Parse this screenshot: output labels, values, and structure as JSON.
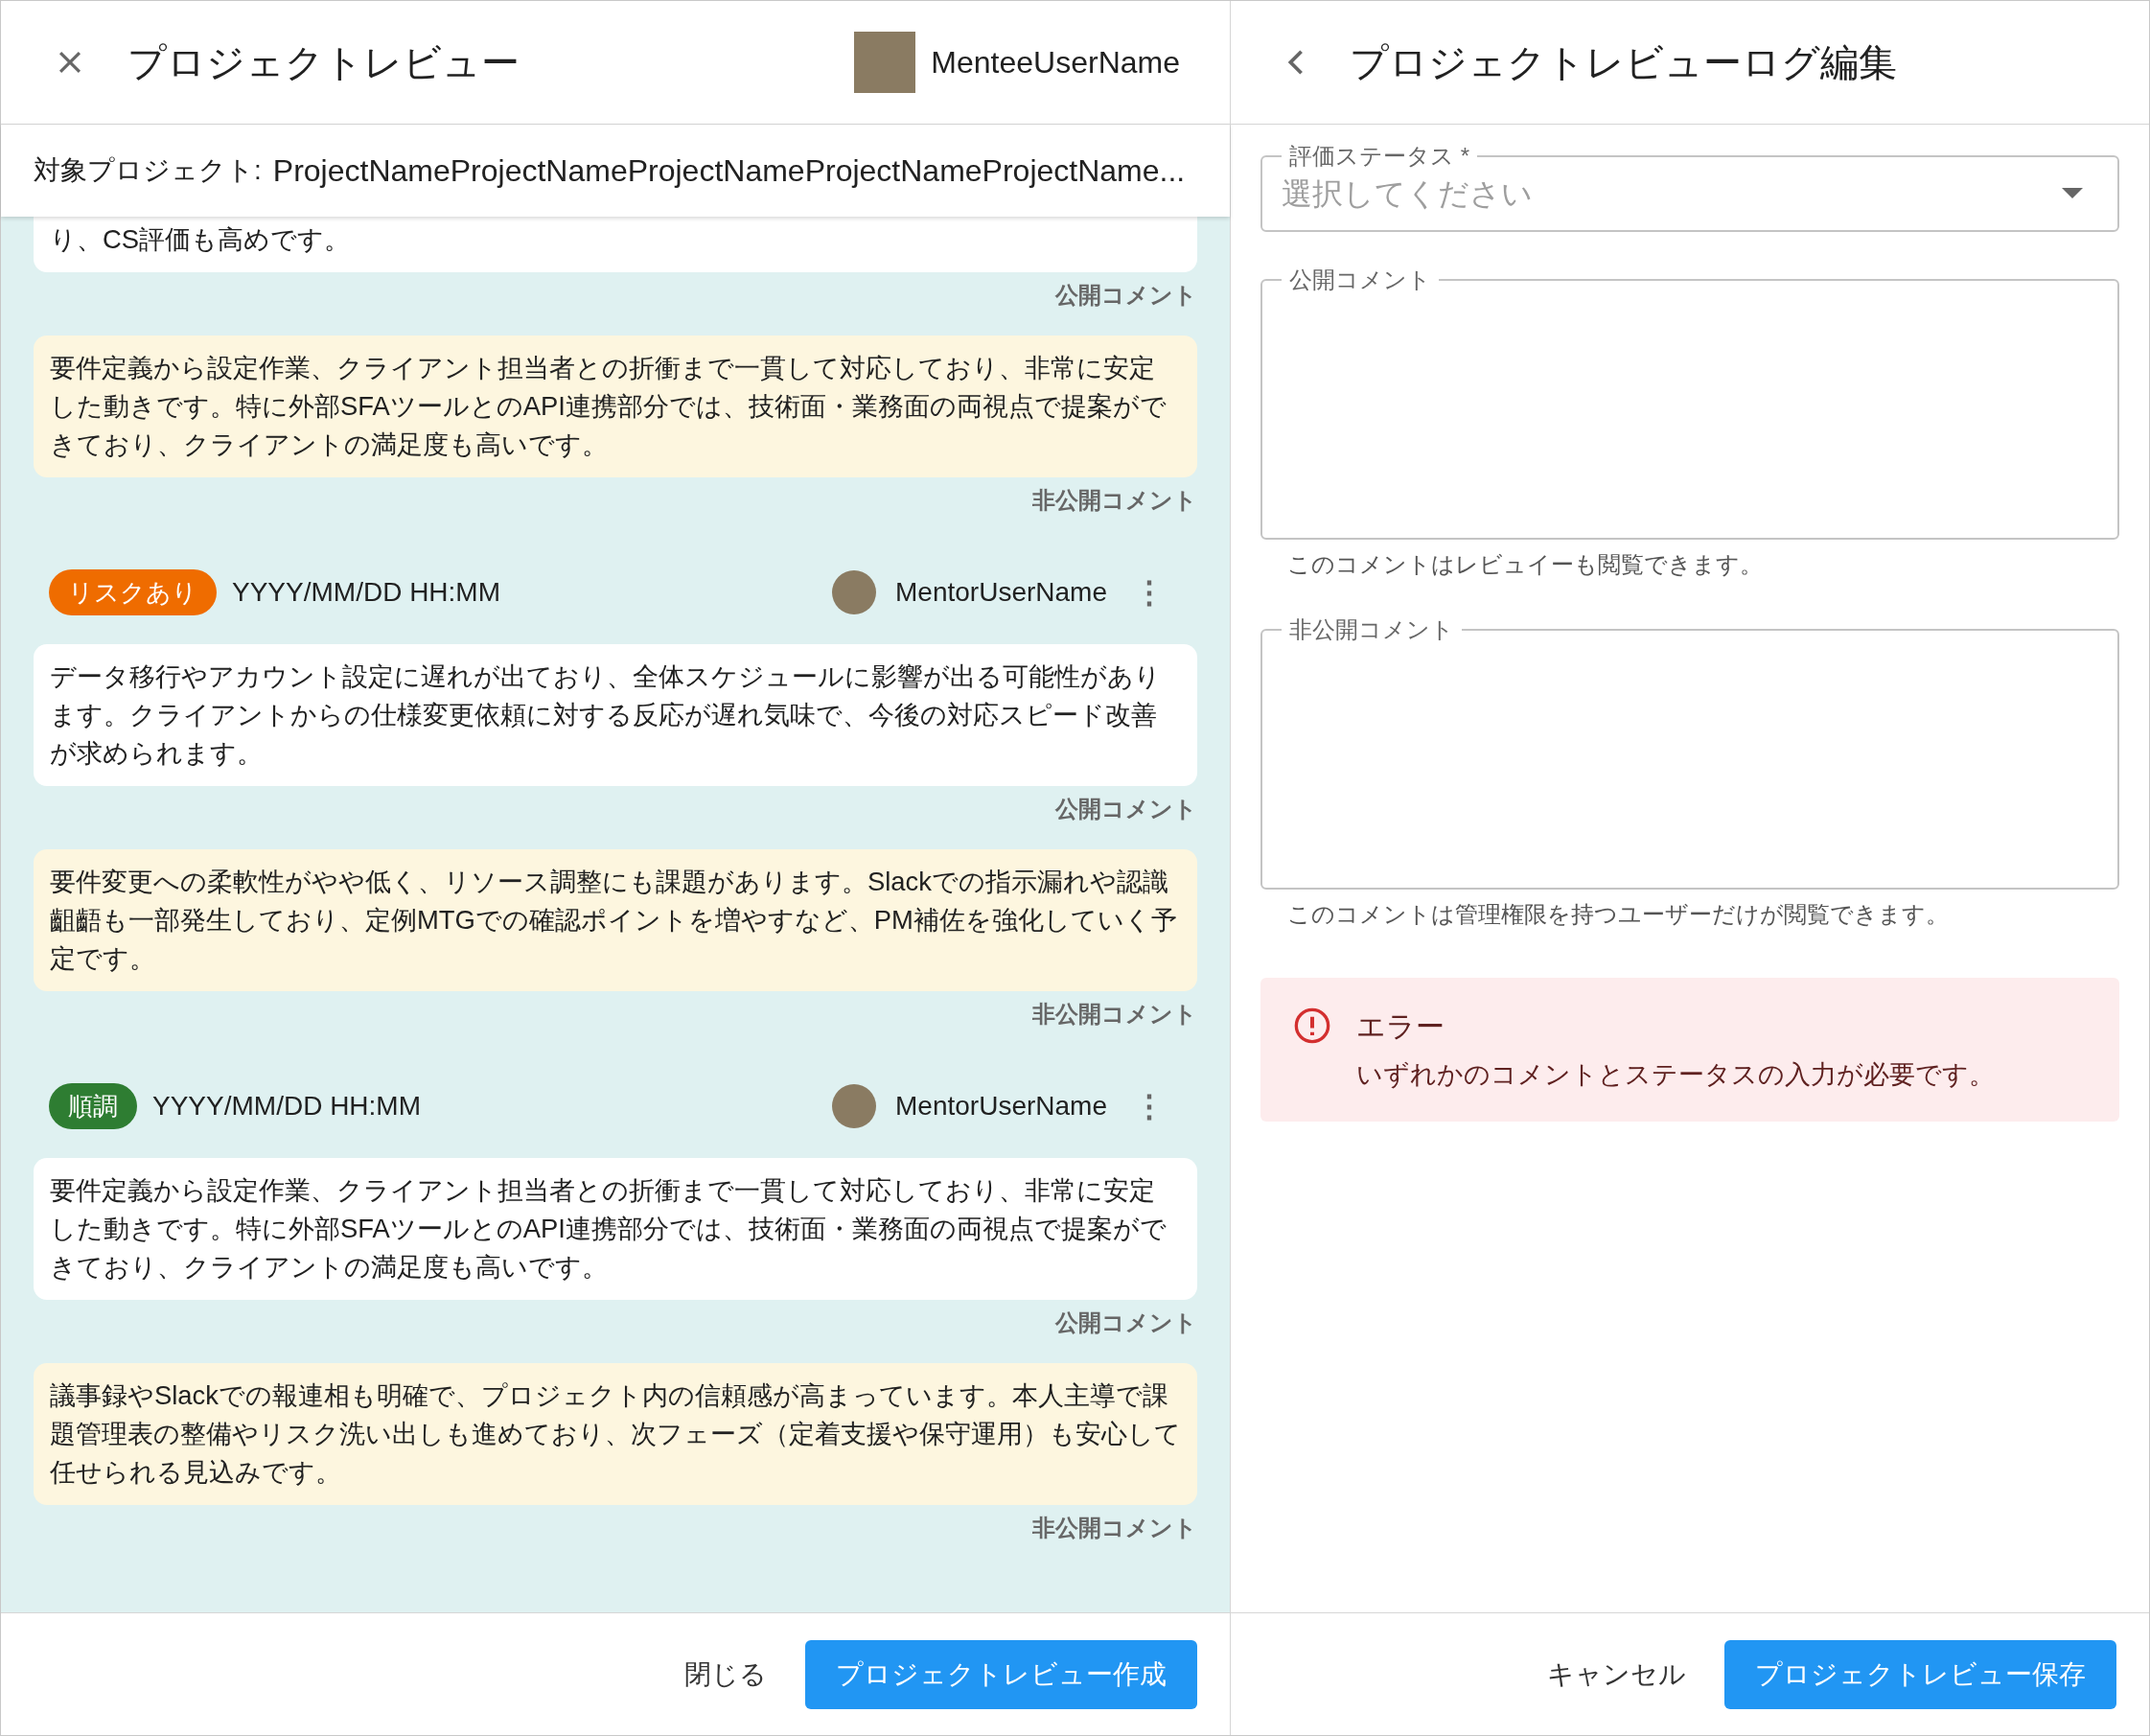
{
  "left_panel": {
    "title": "プロジェクトレビュー",
    "mentee": "MenteeUserName",
    "project_label": "対象プロジェクト:",
    "project_name": "ProjectNameProjectNameProjectNameProjectNameProjectName...",
    "logs": [
      {
        "comments": [
          {
            "kind": "public",
            "text": "り、CS評価も高めです。",
            "label": "公開コメント"
          },
          {
            "kind": "private",
            "text": "要件定義から設定作業、クライアント担当者との折衝まで一貫して対応しており、非常に安定した動きです。特に外部SFAツールとのAPI連携部分では、技術面・業務面の両視点で提案ができており、クライアントの満足度も高いです。",
            "label": "非公開コメント"
          }
        ]
      },
      {
        "status": {
          "label": "リスクあり",
          "color": "#ef6c00"
        },
        "date": "YYYY/MM/DD HH:MM",
        "author": "MentorUserName",
        "menu": "⋮",
        "comments": [
          {
            "kind": "public",
            "text": "データ移行やアカウント設定に遅れが出ており、全体スケジュールに影響が出る可能性があります。クライアントからの仕様変更依頼に対する反応が遅れ気味で、今後の対応スピード改善が求められます。",
            "label": "公開コメント"
          },
          {
            "kind": "private",
            "text": "要件変更への柔軟性がやや低く、リソース調整にも課題があります。Slackでの指示漏れや認識齟齬も一部発生しており、定例MTGでの確認ポイントを増やすなど、PM補佐を強化していく予定です。",
            "label": "非公開コメント"
          }
        ]
      },
      {
        "status": {
          "label": "順調",
          "color": "#2e7d32"
        },
        "date": "YYYY/MM/DD HH:MM",
        "author": "MentorUserName",
        "menu": "⋮",
        "comments": [
          {
            "kind": "public",
            "text": "要件定義から設定作業、クライアント担当者との折衝まで一貫して対応しており、非常に安定した動きです。特に外部SFAツールとのAPI連携部分では、技術面・業務面の両視点で提案ができており、クライアントの満足度も高いです。",
            "label": "公開コメント"
          },
          {
            "kind": "private",
            "text": "議事録やSlackでの報連相も明確で、プロジェクト内の信頼感が高まっています。本人主導で課題管理表の整備やリスク洗い出しも進めており、次フェーズ（定着支援や保守運用）も安心して任せられる見込みです。",
            "label": "非公開コメント"
          }
        ]
      }
    ],
    "buttons": [
      {
        "kind": "text",
        "label": "閉じる"
      },
      {
        "kind": "primary",
        "label": "プロジェクトレビュー作成"
      }
    ]
  },
  "right_panel": {
    "title": "プロジェクトレビューログ編集",
    "status_field": {
      "label": "評価ステータス *",
      "placeholder": "選択してください"
    },
    "public_comment": {
      "label": "公開コメント",
      "helper": "このコメントはレビュイーも閲覧できます。"
    },
    "private_comment": {
      "label": "非公開コメント",
      "helper": "このコメントは管理権限を持つユーザーだけが閲覧できます。"
    },
    "error": {
      "title": "エラー",
      "message": "いずれかのコメントとステータスの入力が必要です。"
    },
    "buttons": [
      {
        "kind": "text",
        "label": "キャンセル"
      },
      {
        "kind": "primary",
        "label": "プロジェクトレビュー保存"
      }
    ]
  }
}
